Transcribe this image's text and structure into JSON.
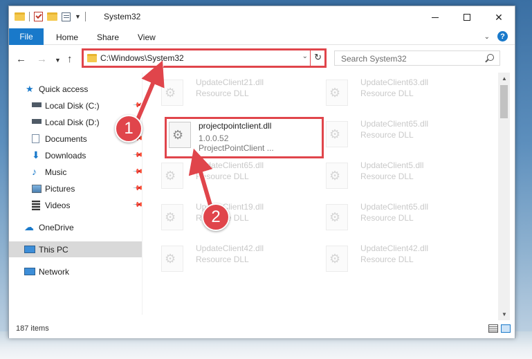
{
  "window": {
    "title": "System32"
  },
  "ribbon": {
    "tabs": [
      "File",
      "Home",
      "Share",
      "View"
    ]
  },
  "nav": {
    "address": "C:\\Windows\\System32",
    "search_placeholder": "Search System32"
  },
  "sidebar": {
    "items": [
      {
        "label": "Quick access",
        "icon": "star-icon",
        "pinned": false
      },
      {
        "label": "Local Disk (C:)",
        "icon": "drive-icon",
        "pinned": true
      },
      {
        "label": "Local Disk (D:)",
        "icon": "drive-icon",
        "pinned": false
      },
      {
        "label": "Documents",
        "icon": "documents-icon",
        "pinned": true
      },
      {
        "label": "Downloads",
        "icon": "download-icon",
        "pinned": true
      },
      {
        "label": "Music",
        "icon": "music-icon",
        "pinned": true
      },
      {
        "label": "Pictures",
        "icon": "pictures-icon",
        "pinned": true
      },
      {
        "label": "Videos",
        "icon": "videos-icon",
        "pinned": true
      },
      {
        "label": "OneDrive",
        "icon": "cloud-icon",
        "pinned": false
      },
      {
        "label": "This PC",
        "icon": "computer-icon",
        "pinned": false,
        "selected": true
      },
      {
        "label": "Network",
        "icon": "network-icon",
        "pinned": false
      }
    ]
  },
  "files": {
    "left": [
      {
        "name": "UpdateClient21.dll",
        "type": "Resource DLL"
      },
      {
        "name": "UpdateClient65.dll",
        "type": "Resource DLL"
      },
      {
        "name": "UpdateClient19.dll",
        "type": "Resource DLL"
      },
      {
        "name": "UpdateClient42.dll",
        "type": "Resource DLL"
      }
    ],
    "right": [
      {
        "name": "UpdateClient63.dll",
        "type": "Resource DLL"
      },
      {
        "name": "UpdateClient65.dll",
        "type": "Resource DLL"
      },
      {
        "name": "UpdateClient5.dll",
        "type": "Resource DLL"
      },
      {
        "name": "UpdateClient65.dll",
        "type": "Resource DLL"
      },
      {
        "name": "UpdateClient42.dll",
        "type": "Resource DLL"
      }
    ],
    "highlighted": {
      "name": "projectpointclient.dll",
      "version": "1.0.0.52",
      "description": "ProjectPointClient ..."
    }
  },
  "status": {
    "item_count": "187 items"
  },
  "callouts": [
    "1",
    "2"
  ],
  "colors": {
    "accent": "#1979ca",
    "highlight": "#e0454b"
  }
}
